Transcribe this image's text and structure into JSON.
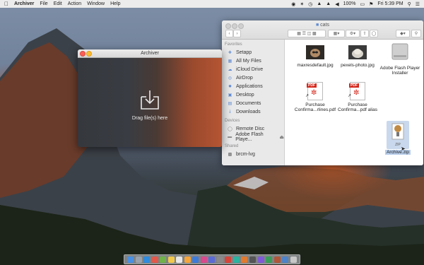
{
  "menubar": {
    "app_name": "Archiver",
    "menus": [
      "File",
      "Edit",
      "Action",
      "Window",
      "Help"
    ],
    "battery": "100%",
    "clock": "Fri 5:39 PM"
  },
  "archiver_window": {
    "title": "Archiver",
    "drop_label": "Drag file(s) here"
  },
  "finder": {
    "title": "cats",
    "sidebar": {
      "favorites_header": "Favorites",
      "favorites": [
        {
          "label": "Setapp",
          "icon": "setapp-icon"
        },
        {
          "label": "All My Files",
          "icon": "all-files-icon"
        },
        {
          "label": "iCloud Drive",
          "icon": "cloud-icon"
        },
        {
          "label": "AirDrop",
          "icon": "airdrop-icon"
        },
        {
          "label": "Applications",
          "icon": "applications-icon"
        },
        {
          "label": "Desktop",
          "icon": "desktop-icon"
        },
        {
          "label": "Documents",
          "icon": "documents-icon"
        },
        {
          "label": "Downloads",
          "icon": "downloads-icon"
        }
      ],
      "devices_header": "Devices",
      "devices": [
        {
          "label": "Remote Disc",
          "icon": "disc-icon"
        },
        {
          "label": "Adobe Flash Playe...",
          "icon": "disk-icon"
        }
      ],
      "shared_header": "Shared",
      "shared": [
        {
          "label": "brcm-lvg",
          "icon": "computer-icon"
        }
      ]
    },
    "files": [
      {
        "name": "maxresdefault.jpg",
        "type": "image"
      },
      {
        "name": "pexels-photo.jpg",
        "type": "image"
      },
      {
        "name": "Adobe Flash Player Installer",
        "type": "installer"
      },
      {
        "name": "Purchase Confirma...rlines.pdf",
        "type": "pdf-alias",
        "badge": "PDF"
      },
      {
        "name": "Purchase Confirma...pdf alias",
        "type": "pdf-alias",
        "badge": "PDF"
      },
      {
        "name": "Archive.zip",
        "type": "zip",
        "badge": "ZIP"
      }
    ]
  }
}
